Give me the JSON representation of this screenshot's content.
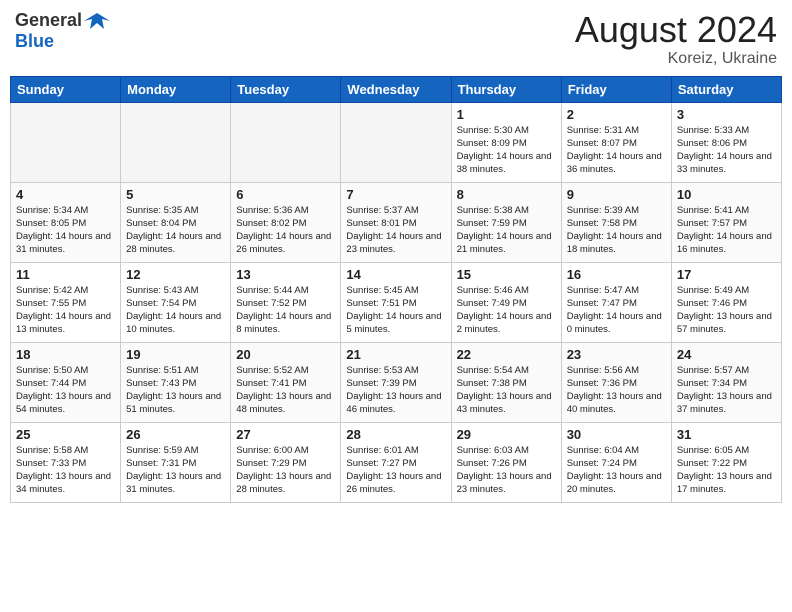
{
  "header": {
    "logo_general": "General",
    "logo_blue": "Blue",
    "month_year": "August 2024",
    "location": "Koreiz, Ukraine"
  },
  "days_of_week": [
    "Sunday",
    "Monday",
    "Tuesday",
    "Wednesday",
    "Thursday",
    "Friday",
    "Saturday"
  ],
  "weeks": [
    [
      {
        "day": "",
        "empty": true
      },
      {
        "day": "",
        "empty": true
      },
      {
        "day": "",
        "empty": true
      },
      {
        "day": "",
        "empty": true
      },
      {
        "day": "1",
        "sunrise": "5:30 AM",
        "sunset": "8:09 PM",
        "daylight": "14 hours and 38 minutes."
      },
      {
        "day": "2",
        "sunrise": "5:31 AM",
        "sunset": "8:07 PM",
        "daylight": "14 hours and 36 minutes."
      },
      {
        "day": "3",
        "sunrise": "5:33 AM",
        "sunset": "8:06 PM",
        "daylight": "14 hours and 33 minutes."
      }
    ],
    [
      {
        "day": "4",
        "sunrise": "5:34 AM",
        "sunset": "8:05 PM",
        "daylight": "14 hours and 31 minutes."
      },
      {
        "day": "5",
        "sunrise": "5:35 AM",
        "sunset": "8:04 PM",
        "daylight": "14 hours and 28 minutes."
      },
      {
        "day": "6",
        "sunrise": "5:36 AM",
        "sunset": "8:02 PM",
        "daylight": "14 hours and 26 minutes."
      },
      {
        "day": "7",
        "sunrise": "5:37 AM",
        "sunset": "8:01 PM",
        "daylight": "14 hours and 23 minutes."
      },
      {
        "day": "8",
        "sunrise": "5:38 AM",
        "sunset": "7:59 PM",
        "daylight": "14 hours and 21 minutes."
      },
      {
        "day": "9",
        "sunrise": "5:39 AM",
        "sunset": "7:58 PM",
        "daylight": "14 hours and 18 minutes."
      },
      {
        "day": "10",
        "sunrise": "5:41 AM",
        "sunset": "7:57 PM",
        "daylight": "14 hours and 16 minutes."
      }
    ],
    [
      {
        "day": "11",
        "sunrise": "5:42 AM",
        "sunset": "7:55 PM",
        "daylight": "14 hours and 13 minutes."
      },
      {
        "day": "12",
        "sunrise": "5:43 AM",
        "sunset": "7:54 PM",
        "daylight": "14 hours and 10 minutes."
      },
      {
        "day": "13",
        "sunrise": "5:44 AM",
        "sunset": "7:52 PM",
        "daylight": "14 hours and 8 minutes."
      },
      {
        "day": "14",
        "sunrise": "5:45 AM",
        "sunset": "7:51 PM",
        "daylight": "14 hours and 5 minutes."
      },
      {
        "day": "15",
        "sunrise": "5:46 AM",
        "sunset": "7:49 PM",
        "daylight": "14 hours and 2 minutes."
      },
      {
        "day": "16",
        "sunrise": "5:47 AM",
        "sunset": "7:47 PM",
        "daylight": "14 hours and 0 minutes."
      },
      {
        "day": "17",
        "sunrise": "5:49 AM",
        "sunset": "7:46 PM",
        "daylight": "13 hours and 57 minutes."
      }
    ],
    [
      {
        "day": "18",
        "sunrise": "5:50 AM",
        "sunset": "7:44 PM",
        "daylight": "13 hours and 54 minutes."
      },
      {
        "day": "19",
        "sunrise": "5:51 AM",
        "sunset": "7:43 PM",
        "daylight": "13 hours and 51 minutes."
      },
      {
        "day": "20",
        "sunrise": "5:52 AM",
        "sunset": "7:41 PM",
        "daylight": "13 hours and 48 minutes."
      },
      {
        "day": "21",
        "sunrise": "5:53 AM",
        "sunset": "7:39 PM",
        "daylight": "13 hours and 46 minutes."
      },
      {
        "day": "22",
        "sunrise": "5:54 AM",
        "sunset": "7:38 PM",
        "daylight": "13 hours and 43 minutes."
      },
      {
        "day": "23",
        "sunrise": "5:56 AM",
        "sunset": "7:36 PM",
        "daylight": "13 hours and 40 minutes."
      },
      {
        "day": "24",
        "sunrise": "5:57 AM",
        "sunset": "7:34 PM",
        "daylight": "13 hours and 37 minutes."
      }
    ],
    [
      {
        "day": "25",
        "sunrise": "5:58 AM",
        "sunset": "7:33 PM",
        "daylight": "13 hours and 34 minutes."
      },
      {
        "day": "26",
        "sunrise": "5:59 AM",
        "sunset": "7:31 PM",
        "daylight": "13 hours and 31 minutes."
      },
      {
        "day": "27",
        "sunrise": "6:00 AM",
        "sunset": "7:29 PM",
        "daylight": "13 hours and 28 minutes."
      },
      {
        "day": "28",
        "sunrise": "6:01 AM",
        "sunset": "7:27 PM",
        "daylight": "13 hours and 26 minutes."
      },
      {
        "day": "29",
        "sunrise": "6:03 AM",
        "sunset": "7:26 PM",
        "daylight": "13 hours and 23 minutes."
      },
      {
        "day": "30",
        "sunrise": "6:04 AM",
        "sunset": "7:24 PM",
        "daylight": "13 hours and 20 minutes."
      },
      {
        "day": "31",
        "sunrise": "6:05 AM",
        "sunset": "7:22 PM",
        "daylight": "13 hours and 17 minutes."
      }
    ]
  ]
}
